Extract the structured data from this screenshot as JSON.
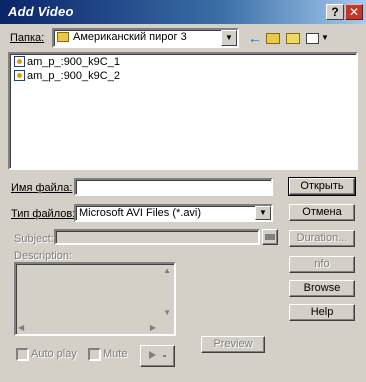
{
  "window": {
    "title": "Add Video",
    "help_glyph": "?",
    "close_glyph": "✕"
  },
  "lookin": {
    "label": "Папка:",
    "value": "Американский пирог 3",
    "back_glyph": "←"
  },
  "files": [
    {
      "name": "am_p_:900_k9C_1"
    },
    {
      "name": "am_p_:900_k9C_2"
    }
  ],
  "filename": {
    "label": "Имя файла:",
    "value": ""
  },
  "filetype": {
    "label": "Тип файлов:",
    "value": "Microsoft AVI Files (*.avi)"
  },
  "subject": {
    "label": "Subject:"
  },
  "description": {
    "label": "Description:"
  },
  "buttons": {
    "open": "Открыть",
    "cancel": "Отмена",
    "duration": "Duration...",
    "info": "nfo",
    "browse": "Browse",
    "help": "Help",
    "preview": "Preview"
  },
  "checkboxes": {
    "autoplay": "Auto play",
    "mute": "Mute"
  },
  "colors": {
    "face": "#d4d0c8",
    "title_start": "#0a246a",
    "title_end": "#a6caf0",
    "close": "#c0392b"
  }
}
